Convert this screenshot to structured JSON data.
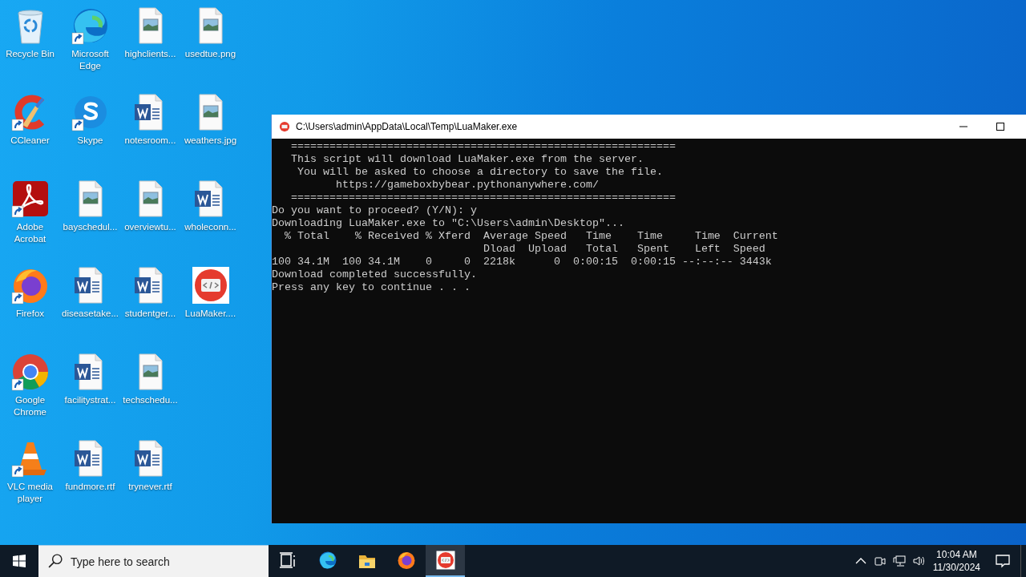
{
  "desktop": {
    "icons": [
      {
        "label": "Recycle Bin",
        "kind": "recycle-bin",
        "shortcut": false
      },
      {
        "label": "CCleaner",
        "kind": "ccleaner",
        "shortcut": true
      },
      {
        "label": "Adobe Acrobat",
        "kind": "acrobat",
        "shortcut": true
      },
      {
        "label": "Firefox",
        "kind": "firefox",
        "shortcut": true
      },
      {
        "label": "Google Chrome",
        "kind": "chrome",
        "shortcut": true
      },
      {
        "label": "VLC media player",
        "kind": "vlc",
        "shortcut": true
      },
      {
        "label": "Microsoft Edge",
        "kind": "edge",
        "shortcut": true
      },
      {
        "label": "Skype",
        "kind": "skype",
        "shortcut": true
      },
      {
        "label": "bayschedul...",
        "kind": "image-file",
        "shortcut": false
      },
      {
        "label": "diseasetake...",
        "kind": "word-file",
        "shortcut": false
      },
      {
        "label": "facilitystrat...",
        "kind": "word-file",
        "shortcut": false
      },
      {
        "label": "fundmore.rtf",
        "kind": "word-file",
        "shortcut": false
      },
      {
        "label": "highclients...",
        "kind": "image-file",
        "shortcut": false
      },
      {
        "label": "notesroom...",
        "kind": "word-file",
        "shortcut": false
      },
      {
        "label": "overviewtu...",
        "kind": "image-file",
        "shortcut": false
      },
      {
        "label": "studentger...",
        "kind": "word-file",
        "shortcut": false
      },
      {
        "label": "techschedu...",
        "kind": "image-file",
        "shortcut": false
      },
      {
        "label": "trynever.rtf",
        "kind": "word-file",
        "shortcut": false
      },
      {
        "label": "usedtue.png",
        "kind": "image-file",
        "shortcut": false
      },
      {
        "label": "weathers.jpg",
        "kind": "image-file",
        "shortcut": false
      },
      {
        "label": "wholeconn...",
        "kind": "word-file",
        "shortcut": false
      },
      {
        "label": "LuaMaker....",
        "kind": "luamaker",
        "shortcut": false
      }
    ]
  },
  "window": {
    "title": "C:\\Users\\admin\\AppData\\Local\\Temp\\LuaMaker.exe",
    "console_lines": [
      "   ============================================================",
      "   This script will download LuaMaker.exe from the server.",
      "    You will be asked to choose a directory to save the file.",
      "          https://gameboxbybear.pythonanywhere.com/",
      "   ============================================================",
      "Do you want to proceed? (Y/N): y",
      "Downloading LuaMaker.exe to \"C:\\Users\\admin\\Desktop\"...",
      "  % Total    % Received % Xferd  Average Speed   Time    Time     Time  Current",
      "                                 Dload  Upload   Total   Spent    Left  Speed",
      "100 34.1M  100 34.1M    0     0  2218k      0  0:00:15  0:00:15 --:--:-- 3443k",
      "Download completed successfully.",
      "Press any key to continue . . ."
    ]
  },
  "taskbar": {
    "search": {
      "placeholder": "Type here to search"
    },
    "apps": [
      {
        "kind": "task-view",
        "selected": false
      },
      {
        "kind": "edge",
        "selected": false
      },
      {
        "kind": "file-explorer",
        "selected": false
      },
      {
        "kind": "firefox",
        "selected": false
      },
      {
        "kind": "luamaker",
        "selected": true
      }
    ],
    "clock": {
      "time": "10:04 AM",
      "date": "11/30/2024"
    }
  }
}
